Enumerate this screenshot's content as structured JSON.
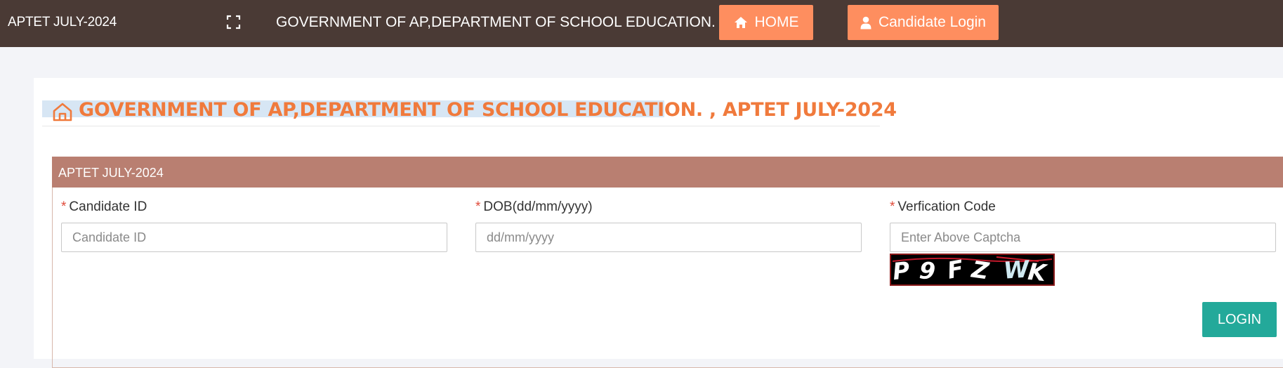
{
  "topbar": {
    "brand": "APTET JULY-2024",
    "title": "GOVERNMENT OF AP,DEPARTMENT OF SCHOOL EDUCATION.",
    "home_label": "HOME",
    "candidate_login_label": "Candidate Login",
    "colors": {
      "background": "#4a3a35",
      "button": "#fe8e5f"
    }
  },
  "page": {
    "heading": "GOVERNMENT OF AP,DEPARTMENT OF SCHOOL EDUCATION. , APTET JULY-2024",
    "heading_color": "#f07a3c"
  },
  "panel": {
    "title": "APTET JULY-2024",
    "header_color": "#b97f71"
  },
  "form": {
    "required_mark": "*",
    "candidate_id": {
      "label": "Candidate ID",
      "placeholder": "Candidate ID",
      "value": ""
    },
    "dob": {
      "label": "DOB(dd/mm/yyyy)",
      "placeholder": "dd/mm/yyyy",
      "value": ""
    },
    "verification": {
      "label": "Verfication Code",
      "placeholder": "Enter Above Captcha",
      "value": ""
    },
    "captcha_text": "P9FZWK",
    "login_label": "LOGIN",
    "login_color": "#23a99a"
  },
  "icons": {
    "fullscreen": "fullscreen-icon",
    "home": "home-icon",
    "user": "user-icon",
    "heading": "home-outline-icon"
  }
}
